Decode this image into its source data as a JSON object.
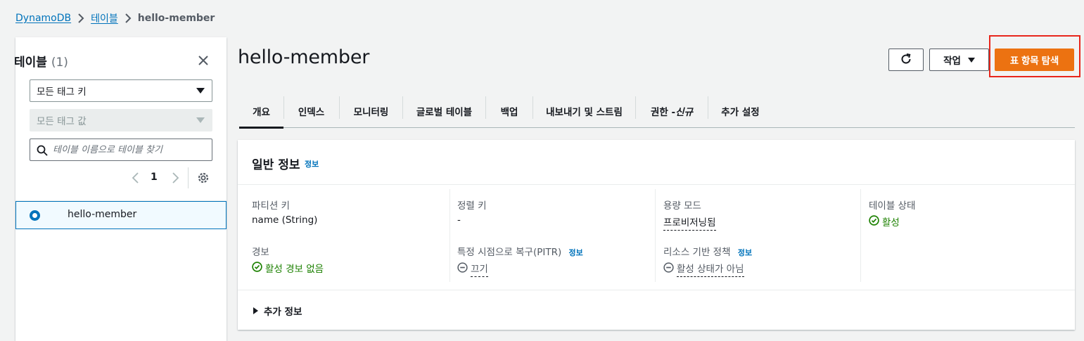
{
  "breadcrumb": {
    "items": [
      "DynamoDB",
      "테이블"
    ],
    "current": "hello-member"
  },
  "sidebar": {
    "title": "테이블",
    "count": "(1)",
    "tag_key_select": "모든 태그 키",
    "tag_value_select": "모든 태그 값",
    "search_placeholder": "테이블 이름으로 테이블 찾기",
    "page_number": "1",
    "tables": [
      "hello-member"
    ]
  },
  "main": {
    "title": "hello-member",
    "actions_label": "작업",
    "explore_label": "표 항목 탐색",
    "tabs": [
      "개요",
      "인덱스",
      "모니터링",
      "글로벌 테이블",
      "백업",
      "내보내기 및 스트림",
      "권한 - ",
      "신규",
      "추가 설정"
    ],
    "general": {
      "title": "일반 정보",
      "info_link": "정보",
      "partition_key_label": "파티션 키",
      "partition_key_value": "name (String)",
      "sort_key_label": "정렬 키",
      "sort_key_value": "-",
      "capacity_label": "용량 모드",
      "capacity_value": "프로비저닝됨",
      "table_status_label": "테이블 상태",
      "table_status_value": "활성",
      "alarms_label": "경보",
      "alarms_value": "활성 경보 없음",
      "pitr_label": "특정 시점으로 복구(PITR)",
      "pitr_info": "정보",
      "pitr_value": "끄기",
      "resource_policy_label": "리소스 기반 정책",
      "resource_policy_info": "정보",
      "resource_policy_value": "활성 상태가 아님",
      "additional_info": "추가 정보"
    }
  },
  "colors": {
    "primary": "#ec7211",
    "link": "#0073bb",
    "success": "#1d8102",
    "highlight": "#e8261c"
  }
}
